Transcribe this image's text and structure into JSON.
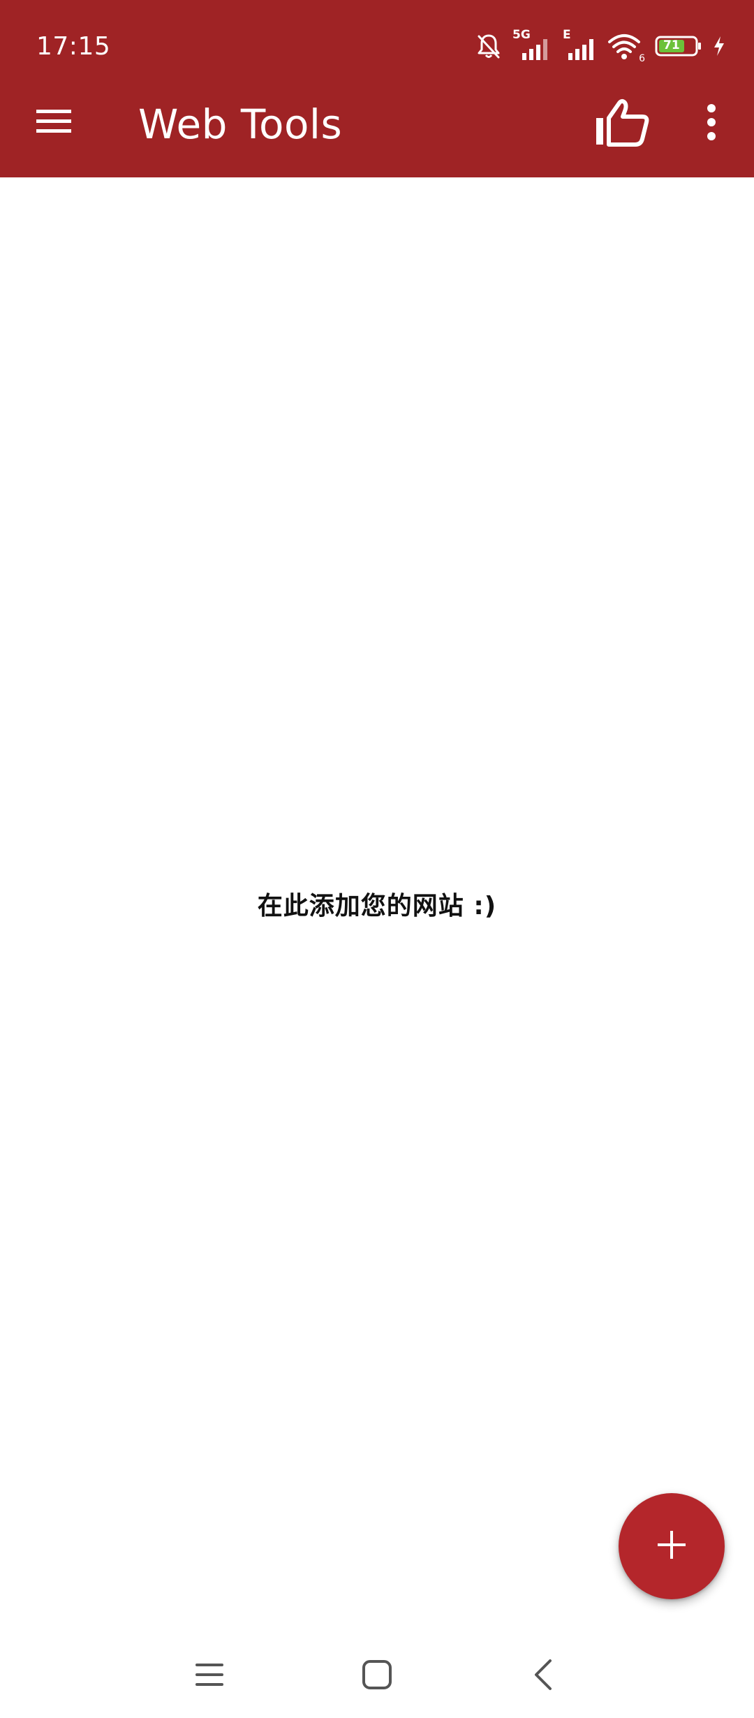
{
  "status_bar": {
    "time": "17:15",
    "network_label": "5G",
    "network_label_2": "E",
    "wifi_badge": "6",
    "battery_level": "71",
    "icons": [
      "bell-muted-icon",
      "signal-5g-icon",
      "signal-e-icon",
      "wifi-icon",
      "battery-icon",
      "charging-bolt-icon"
    ]
  },
  "app_bar": {
    "title": "Web Tools",
    "icons": [
      "menu-icon",
      "thumbs-up-icon",
      "more-vert-icon"
    ]
  },
  "main": {
    "empty_message": "在此添加您的网站 :)"
  },
  "fab": {
    "icon": "plus-icon"
  },
  "nav_bar": {
    "icons": [
      "recents-icon",
      "home-icon",
      "back-icon"
    ]
  },
  "colors": {
    "app_bar_bg": "#9f2325",
    "fab_bg": "#b4262b",
    "battery_fill": "#6cc13a"
  }
}
